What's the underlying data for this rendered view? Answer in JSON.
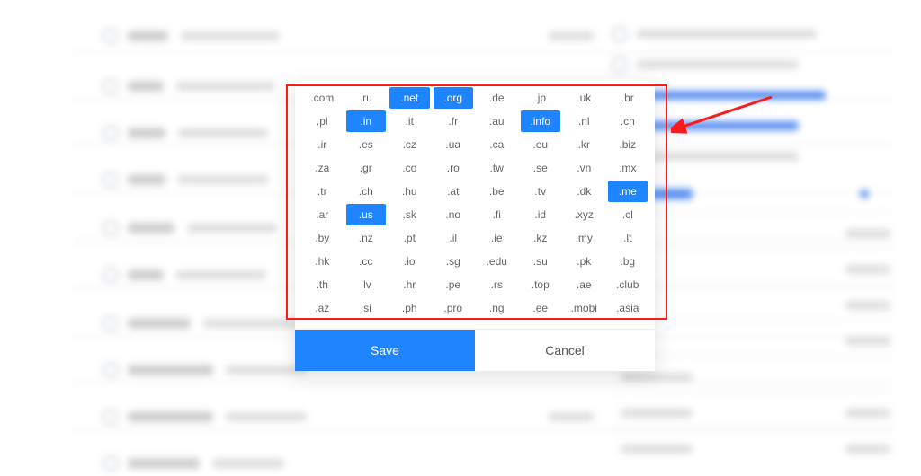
{
  "modal": {
    "save_label": "Save",
    "cancel_label": "Cancel",
    "tlds": [
      {
        "t": ".com",
        "s": false
      },
      {
        "t": ".ru",
        "s": false
      },
      {
        "t": ".net",
        "s": true
      },
      {
        "t": ".org",
        "s": true
      },
      {
        "t": ".de",
        "s": false
      },
      {
        "t": ".jp",
        "s": false
      },
      {
        "t": ".uk",
        "s": false
      },
      {
        "t": ".br",
        "s": false
      },
      {
        "t": ".pl",
        "s": false
      },
      {
        "t": ".in",
        "s": true
      },
      {
        "t": ".it",
        "s": false
      },
      {
        "t": ".fr",
        "s": false
      },
      {
        "t": ".au",
        "s": false
      },
      {
        "t": ".info",
        "s": true
      },
      {
        "t": ".nl",
        "s": false
      },
      {
        "t": ".cn",
        "s": false
      },
      {
        "t": ".ir",
        "s": false
      },
      {
        "t": ".es",
        "s": false
      },
      {
        "t": ".cz",
        "s": false
      },
      {
        "t": ".ua",
        "s": false
      },
      {
        "t": ".ca",
        "s": false
      },
      {
        "t": ".eu",
        "s": false
      },
      {
        "t": ".kr",
        "s": false
      },
      {
        "t": ".biz",
        "s": false
      },
      {
        "t": ".za",
        "s": false
      },
      {
        "t": ".gr",
        "s": false
      },
      {
        "t": ".co",
        "s": false
      },
      {
        "t": ".ro",
        "s": false
      },
      {
        "t": ".tw",
        "s": false
      },
      {
        "t": ".se",
        "s": false
      },
      {
        "t": ".vn",
        "s": false
      },
      {
        "t": ".mx",
        "s": false
      },
      {
        "t": ".tr",
        "s": false
      },
      {
        "t": ".ch",
        "s": false
      },
      {
        "t": ".hu",
        "s": false
      },
      {
        "t": ".at",
        "s": false
      },
      {
        "t": ".be",
        "s": false
      },
      {
        "t": ".tv",
        "s": false
      },
      {
        "t": ".dk",
        "s": false
      },
      {
        "t": ".me",
        "s": true
      },
      {
        "t": ".ar",
        "s": false
      },
      {
        "t": ".us",
        "s": true
      },
      {
        "t": ".sk",
        "s": false
      },
      {
        "t": ".no",
        "s": false
      },
      {
        "t": ".fi",
        "s": false
      },
      {
        "t": ".id",
        "s": false
      },
      {
        "t": ".xyz",
        "s": false
      },
      {
        "t": ".cl",
        "s": false
      },
      {
        "t": ".by",
        "s": false
      },
      {
        "t": ".nz",
        "s": false
      },
      {
        "t": ".pt",
        "s": false
      },
      {
        "t": ".il",
        "s": false
      },
      {
        "t": ".ie",
        "s": false
      },
      {
        "t": ".kz",
        "s": false
      },
      {
        "t": ".my",
        "s": false
      },
      {
        "t": ".lt",
        "s": false
      },
      {
        "t": ".hk",
        "s": false
      },
      {
        "t": ".cc",
        "s": false
      },
      {
        "t": ".io",
        "s": false
      },
      {
        "t": ".sg",
        "s": false
      },
      {
        "t": ".edu",
        "s": false
      },
      {
        "t": ".su",
        "s": false
      },
      {
        "t": ".pk",
        "s": false
      },
      {
        "t": ".bg",
        "s": false
      },
      {
        "t": ".th",
        "s": false
      },
      {
        "t": ".lv",
        "s": false
      },
      {
        "t": ".hr",
        "s": false
      },
      {
        "t": ".pe",
        "s": false
      },
      {
        "t": ".rs",
        "s": false
      },
      {
        "t": ".top",
        "s": false
      },
      {
        "t": ".ae",
        "s": false
      },
      {
        "t": ".club",
        "s": false
      },
      {
        "t": ".az",
        "s": false
      },
      {
        "t": ".si",
        "s": false
      },
      {
        "t": ".ph",
        "s": false
      },
      {
        "t": ".pro",
        "s": false
      },
      {
        "t": ".ng",
        "s": false
      },
      {
        "t": ".ee",
        "s": false
      },
      {
        "t": ".mobi",
        "s": false
      },
      {
        "t": ".asia",
        "s": false
      }
    ]
  }
}
